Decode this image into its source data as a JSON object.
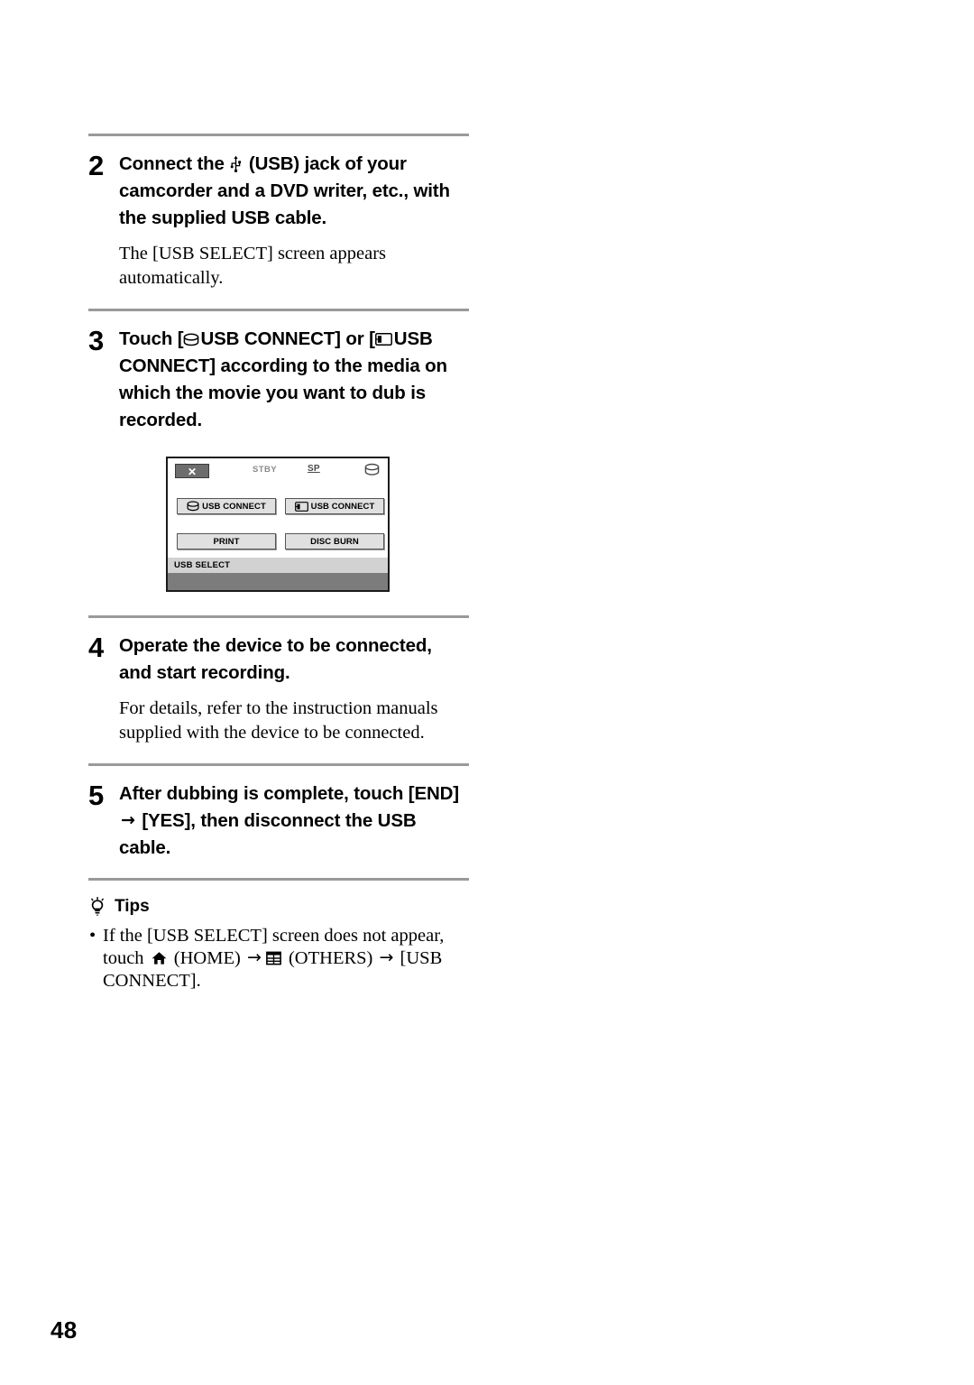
{
  "page": {
    "number": "48",
    "rule_color": "#9a9a9a"
  },
  "steps": [
    {
      "number": "2",
      "title_pre": "Connect the ",
      "icon": "usb-icon",
      "title_post": " (USB) jack of your camcorder and a DVD writer, etc., with the supplied USB cable.",
      "body": "The [USB SELECT] screen appears automatically."
    },
    {
      "number": "3",
      "title_a": "Touch [",
      "icon_a": "hard-disk-icon",
      "title_b": "USB CONNECT] or [",
      "icon_b": "memory-card-icon",
      "title_c": "USB CONNECT] according to the media on which the movie you want to dub is recorded."
    },
    {
      "number": "4",
      "title": "Operate the device to be connected, and start recording.",
      "body": "For details, refer to the instruction manuals supplied with the device to be connected."
    },
    {
      "number": "5",
      "title_a": "After dubbing is complete, touch [END] ",
      "arrow": "→",
      "title_b": " [YES], then disconnect the USB cable."
    }
  ],
  "figure": {
    "name": "usb-select-screen",
    "close_label": "✕",
    "status_stby": "STBY",
    "status_mode": "SP",
    "media_icon": "hard-disk-icon",
    "buttons": [
      {
        "name": "usb-connect-hdd",
        "icon": "hard-disk-icon",
        "label": "USB CONNECT"
      },
      {
        "name": "usb-connect-card",
        "icon": "memory-card-icon",
        "label": "USB CONNECT"
      },
      {
        "name": "print",
        "icon": "",
        "label": "PRINT"
      },
      {
        "name": "disc-burn",
        "icon": "",
        "label": "DISC BURN"
      }
    ],
    "screen_title": "USB SELECT",
    "colors": {
      "button_face": "#e0e0e0",
      "title_bar": "#d2d2d2",
      "footer": "#7c7c7c",
      "close_button": "#6d6d6d",
      "border": "#1b1b1b"
    }
  },
  "tips": {
    "heading": "Tips",
    "icon": "lightbulb-icon",
    "items": [
      {
        "part_a": "If the [USB SELECT] screen does not appear, touch ",
        "icon_home": "home-icon",
        "part_b": " (HOME) ",
        "arrow_1": "→",
        "icon_others": "others-grid-icon",
        "part_c": " (OTHERS) ",
        "arrow_2": "→",
        "part_d": " [USB CONNECT]."
      }
    ]
  }
}
